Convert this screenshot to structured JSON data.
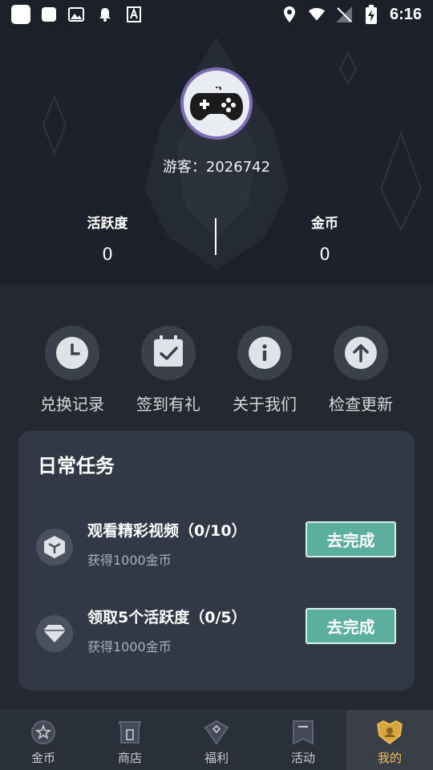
{
  "status_bar": {
    "time": "6:16"
  },
  "profile": {
    "guest_label": "游客：2026742",
    "stats": [
      {
        "label": "活跃度",
        "value": "0"
      },
      {
        "label": "金币",
        "value": "0"
      }
    ]
  },
  "actions": [
    {
      "label": "兑换记录",
      "icon": "clock-icon"
    },
    {
      "label": "签到有礼",
      "icon": "calendar-check-icon"
    },
    {
      "label": "关于我们",
      "icon": "info-icon"
    },
    {
      "label": "检查更新",
      "icon": "arrow-up-icon"
    }
  ],
  "daily_tasks": {
    "title": "日常任务",
    "items": [
      {
        "name": "观看精彩视频（0/10）",
        "reward": "获得1000金币",
        "button": "去完成",
        "icon": "cube-icon"
      },
      {
        "name": "领取5个活跃度（0/5）",
        "reward": "获得1000金币",
        "button": "去完成",
        "icon": "diamond-icon"
      }
    ]
  },
  "bottom_nav": [
    {
      "label": "金币",
      "icon": "coin-icon"
    },
    {
      "label": "商店",
      "icon": "shop-icon"
    },
    {
      "label": "福利",
      "icon": "gift-diamond-icon"
    },
    {
      "label": "活动",
      "icon": "bookmark-icon"
    },
    {
      "label": "我的",
      "icon": "profile-crest-icon",
      "active": true
    }
  ],
  "colors": {
    "background": "#24292f",
    "card": "#323946",
    "button": "#5cae9e",
    "active_nav_label": "#f2c25a",
    "avatar_border": "#7d6bb6"
  }
}
